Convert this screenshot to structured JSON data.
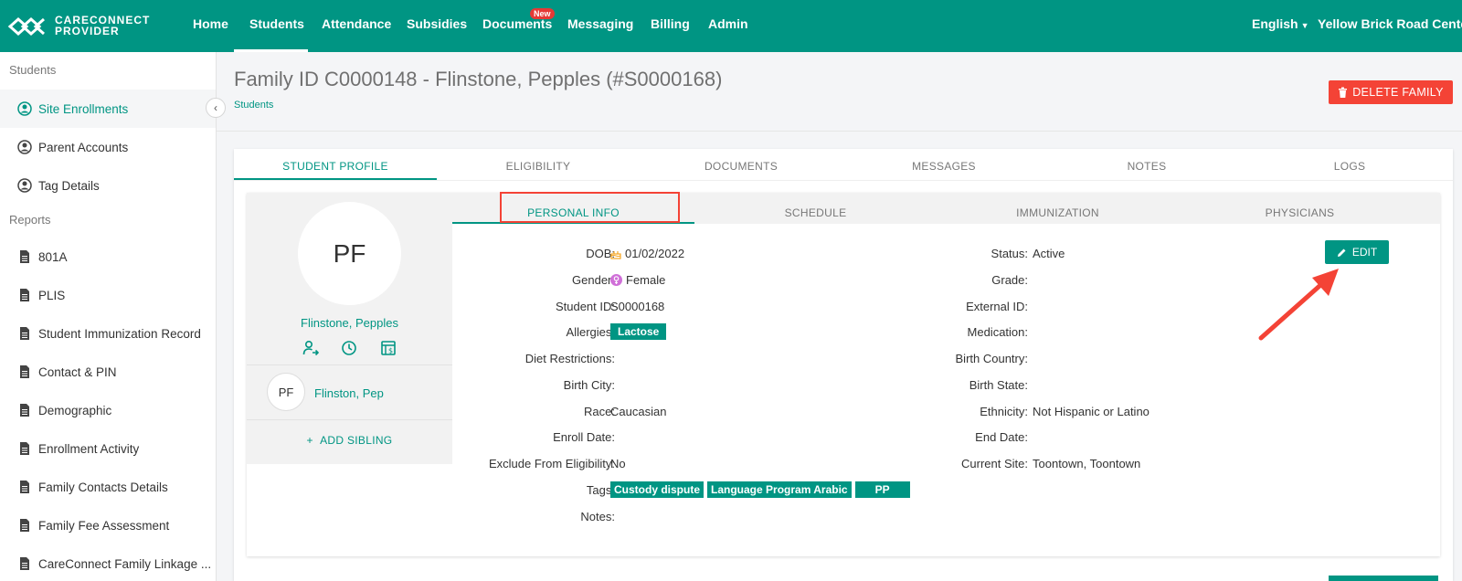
{
  "brand": {
    "line1": "CARECONNECT",
    "line2": "PROVIDER"
  },
  "nav": {
    "items": [
      "Home",
      "Students",
      "Attendance",
      "Subsidies",
      "Documents",
      "Messaging",
      "Billing",
      "Admin"
    ],
    "active": "Students",
    "new_badge": "New",
    "language": "English",
    "center": "Yellow Brick Road Center"
  },
  "sidebar": {
    "students_heading": "Students",
    "student_items": [
      "Site Enrollments",
      "Parent Accounts",
      "Tag Details"
    ],
    "reports_heading": "Reports",
    "report_items": [
      "801A",
      "PLIS",
      "Student Immunization Record",
      "Contact & PIN",
      "Demographic",
      "Enrollment Activity",
      "Family Contacts Details",
      "Family Fee Assessment",
      "CareConnect Family Linkage ..."
    ]
  },
  "page": {
    "title": "Family ID C0000148 - Flinstone, Pepples (#S0000168)",
    "breadcrumb": "Students",
    "delete_label": "DELETE FAMILY"
  },
  "main_tabs": [
    "STUDENT PROFILE",
    "ELIGIBILITY",
    "DOCUMENTS",
    "MESSAGES",
    "NOTES",
    "LOGS"
  ],
  "profile": {
    "initials": "PF",
    "name": "Flinstone, Pepples",
    "sibling_initials": "PF",
    "sibling_name": "Flinston, Pep",
    "add_sibling": "ADD SIBLING"
  },
  "sub_tabs": [
    "PERSONAL INFO",
    "SCHEDULE",
    "IMMUNIZATION",
    "PHYSICIANS"
  ],
  "edit_label": "EDIT",
  "left_fields": [
    {
      "label": "DOB:",
      "value": "01/02/2022"
    },
    {
      "label": "Gender:",
      "value": "Female"
    },
    {
      "label": "Student ID:",
      "value": "S0000168"
    },
    {
      "label": "Allergies:",
      "value": "Lactose"
    },
    {
      "label": "Diet Restrictions:",
      "value": ""
    },
    {
      "label": "Birth City:",
      "value": ""
    },
    {
      "label": "Race:",
      "value": "Caucasian"
    },
    {
      "label": "Enroll Date:",
      "value": ""
    },
    {
      "label": "Exclude From Eligibility:",
      "value": "No"
    },
    {
      "label": "Tags:",
      "value": ""
    },
    {
      "label": "Notes:",
      "value": ""
    }
  ],
  "tags": [
    "Custody dispute",
    "Language Program Arabic",
    "PP"
  ],
  "right_fields": [
    {
      "label": "Status:",
      "value": "Active"
    },
    {
      "label": "Grade:",
      "value": ""
    },
    {
      "label": "External ID:",
      "value": ""
    },
    {
      "label": "Medication:",
      "value": ""
    },
    {
      "label": "Birth Country:",
      "value": ""
    },
    {
      "label": "Birth State:",
      "value": ""
    },
    {
      "label": "Ethnicity:",
      "value": "Not Hispanic or Latino"
    },
    {
      "label": "End Date:",
      "value": ""
    },
    {
      "label": "Current Site:",
      "value": "Toontown, Toontown"
    }
  ],
  "colors": {
    "brand": "#009583",
    "danger": "#f44336"
  }
}
